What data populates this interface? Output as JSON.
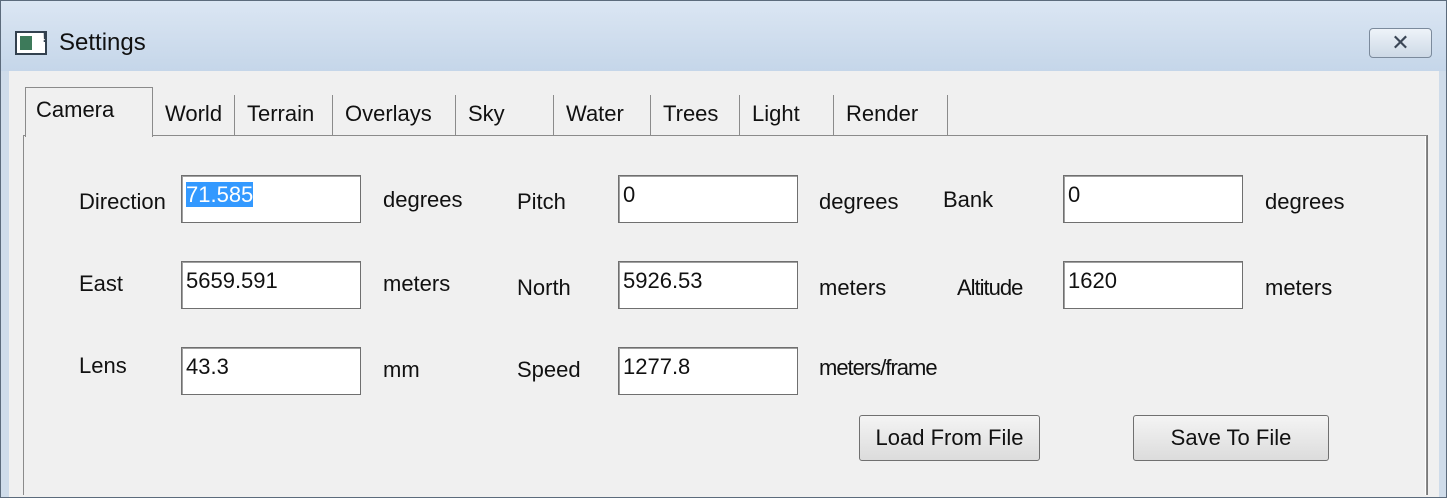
{
  "window": {
    "title": "Settings",
    "close_glyph": "✕"
  },
  "tabs": [
    "Camera",
    "World",
    "Terrain",
    "Overlays",
    "Sky",
    "Water",
    "Trees",
    "Light",
    "Render"
  ],
  "camera": {
    "direction": {
      "label": "Direction",
      "value": "71.585",
      "unit": "degrees"
    },
    "pitch": {
      "label": "Pitch",
      "value": "0",
      "unit": "degrees"
    },
    "bank": {
      "label": "Bank",
      "value": "0",
      "unit": "degrees"
    },
    "east": {
      "label": "East",
      "value": "5659.591",
      "unit": "meters"
    },
    "north": {
      "label": "North",
      "value": "5926.53",
      "unit": "meters"
    },
    "altitude": {
      "label": "Altitude",
      "value": "1620",
      "unit": "meters"
    },
    "lens": {
      "label": "Lens",
      "value": "43.3",
      "unit": "mm"
    },
    "speed": {
      "label": "Speed",
      "value": "1277.8",
      "unit": "meters/frame"
    }
  },
  "buttons": {
    "load": "Load From File",
    "save": "Save To File"
  },
  "colors": {
    "selection": "#3399ff",
    "titlebar": "#cfdcea"
  }
}
